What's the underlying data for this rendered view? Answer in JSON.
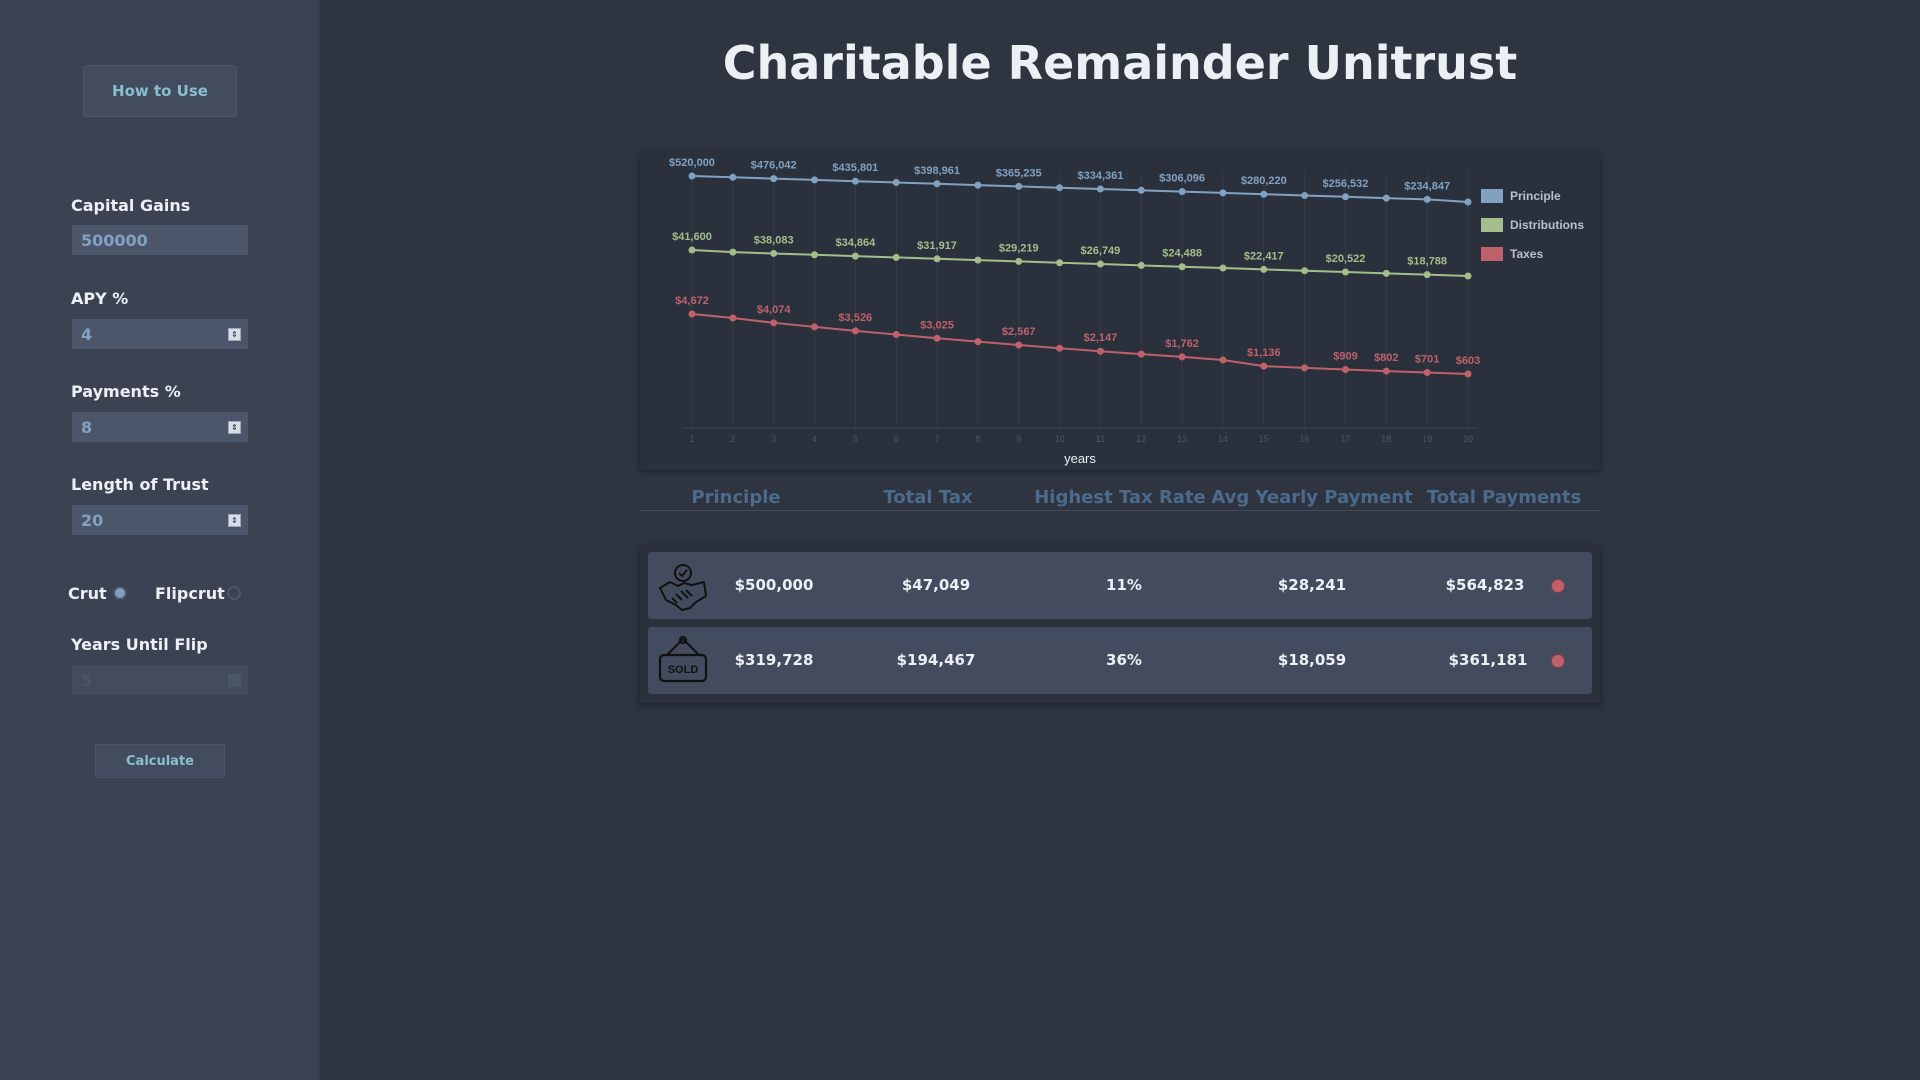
{
  "sidebar": {
    "how_to_use": "How to Use",
    "fields": {
      "capital_gains": {
        "label": "Capital Gains",
        "value": "500000"
      },
      "apy": {
        "label": "APY %",
        "value": "4"
      },
      "payments": {
        "label": "Payments %",
        "value": "8"
      },
      "length": {
        "label": "Length of Trust",
        "value": "20"
      },
      "years_until_flip": {
        "label": "Years Until Flip",
        "value": "5"
      }
    },
    "radio": {
      "crut": "Crut",
      "flipcrut": "Flipcrut",
      "selected": "crut"
    },
    "calculate": "Calculate"
  },
  "title": "Charitable Remainder Unitrust",
  "chart_data": {
    "type": "line",
    "x": [
      1,
      2,
      3,
      4,
      5,
      6,
      7,
      8,
      9,
      10,
      11,
      12,
      13,
      14,
      15,
      16,
      17,
      18,
      19,
      20
    ],
    "xlabel": "years",
    "x_tick_labels": [
      "1",
      "2",
      "3",
      "4",
      "5",
      "6",
      "7",
      "8",
      "9",
      "10",
      "11",
      "12",
      "13",
      "14",
      "15",
      "16",
      "17",
      "18",
      "19",
      "20"
    ],
    "legend_position": "right",
    "series": [
      {
        "name": "Principle",
        "color": "#81a1c1",
        "values": [
          520000,
          519000,
          518000,
          517000,
          516000,
          515000,
          514000,
          513000,
          512000,
          511000,
          510000,
          509000,
          508000,
          507000,
          506000,
          505000,
          504000,
          503000,
          502000,
          500000
        ],
        "point_labels": [
          "$520,000",
          "",
          "$476,042",
          "",
          "$435,801",
          "",
          "$398,961",
          "",
          "$365,235",
          "",
          "$334,361",
          "",
          "$306,096",
          "",
          "$280,220",
          "",
          "$256,532",
          "",
          "$234,847",
          ""
        ]
      },
      {
        "name": "Distributions",
        "color": "#a3be8c",
        "values": [
          41600,
          40000,
          39000,
          38000,
          37000,
          36000,
          35000,
          34000,
          33000,
          32000,
          31000,
          30000,
          29000,
          28000,
          27000,
          26000,
          25000,
          24000,
          23000,
          22000
        ],
        "point_labels": [
          "$41,600",
          "",
          "$38,083",
          "",
          "$34,864",
          "",
          "$31,917",
          "",
          "$29,219",
          "",
          "$26,749",
          "",
          "$24,488",
          "",
          "$22,417",
          "",
          "$20,522",
          "",
          "$18,788",
          ""
        ]
      },
      {
        "name": "Taxes",
        "color": "#bf616a",
        "values": [
          4672,
          4400,
          4074,
          3800,
          3526,
          3280,
          3025,
          2800,
          2567,
          2350,
          2147,
          1950,
          1762,
          1550,
          1136,
          1020,
          909,
          802,
          701,
          603
        ],
        "point_labels": [
          "$4,672",
          "",
          "$4,074",
          "",
          "$3,526",
          "",
          "$3,025",
          "",
          "$2,567",
          "",
          "$2,147",
          "",
          "$1,762",
          "",
          "$1,136",
          "",
          "$909",
          "$802",
          "$701",
          "$603"
        ]
      }
    ]
  },
  "summary": {
    "headers": [
      "Principle",
      "Total Tax",
      "Highest Tax Rate",
      "Avg Yearly Payment",
      "Total Payments"
    ],
    "rows": [
      {
        "icon": "handshake-icon",
        "principle": "$500,000",
        "total_tax": "$47,049",
        "highest_rate": "11%",
        "avg_payment": "$28,241",
        "total_payments": "$564,823"
      },
      {
        "icon": "sold-sign-icon",
        "principle": "$319,728",
        "total_tax": "$194,467",
        "highest_rate": "36%",
        "avg_payment": "$18,059",
        "total_payments": "$361,181"
      }
    ],
    "dot_color": "#bf616a"
  }
}
